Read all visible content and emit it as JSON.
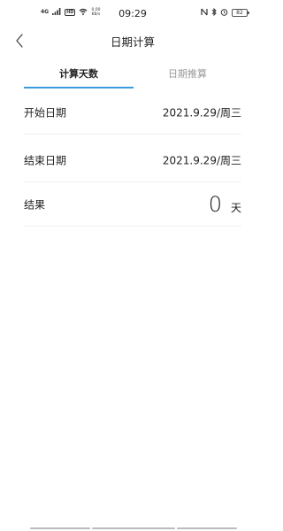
{
  "status_bar": {
    "signal_label": "4G",
    "hd_label": "HD",
    "net_speed_value": "0.00",
    "net_speed_unit": "KB/s",
    "time": "09:29",
    "battery": "82",
    "icons": [
      "signal-icon",
      "wifi-icon",
      "nfc-icon",
      "bluetooth-icon",
      "alarm-icon",
      "battery-icon"
    ]
  },
  "header": {
    "title": "日期计算",
    "back_icon": "back-chevron-icon"
  },
  "tabs": [
    {
      "label": "计算天数",
      "active": true
    },
    {
      "label": "日期推算",
      "active": false
    }
  ],
  "rows": {
    "start": {
      "label": "开始日期",
      "value": "2021.9.29/周三"
    },
    "end": {
      "label": "结束日期",
      "value": "2021.9.29/周三"
    },
    "result": {
      "label": "结果",
      "value": "0",
      "unit": "天"
    }
  },
  "colors": {
    "accent": "#3a9bdf",
    "text": "#222222",
    "inactive_tab": "#999999",
    "divider": "#f0f0f0"
  }
}
